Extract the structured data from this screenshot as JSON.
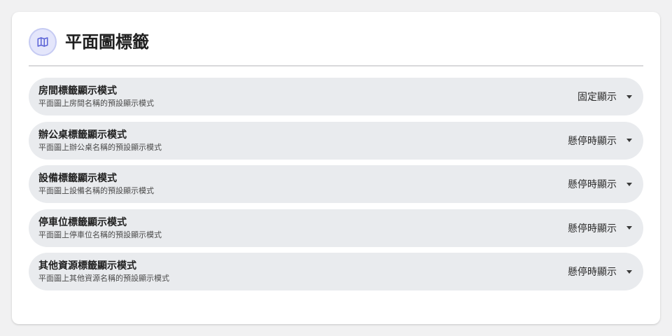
{
  "header": {
    "title": "平面圖標籤",
    "icon": "map-icon",
    "icon_bg": "#e4e6fb",
    "icon_color": "#5b63d6"
  },
  "settings": [
    {
      "title": "房間標籤顯示模式",
      "description": "平面圖上房間名稱的預設顯示模式",
      "value": "固定顯示"
    },
    {
      "title": "辦公桌標籤顯示模式",
      "description": "平面圖上辦公桌名稱的預設顯示模式",
      "value": "懸停時顯示"
    },
    {
      "title": "設備標籤顯示模式",
      "description": "平面圖上設備名稱的預設顯示模式",
      "value": "懸停時顯示"
    },
    {
      "title": "停車位標籤顯示模式",
      "description": "平面圖上停車位名稱的預設顯示模式",
      "value": "懸停時顯示"
    },
    {
      "title": "其他資源標籤顯示模式",
      "description": "平面圖上其他資源名稱的預設顯示模式",
      "value": "懸停時顯示"
    }
  ]
}
